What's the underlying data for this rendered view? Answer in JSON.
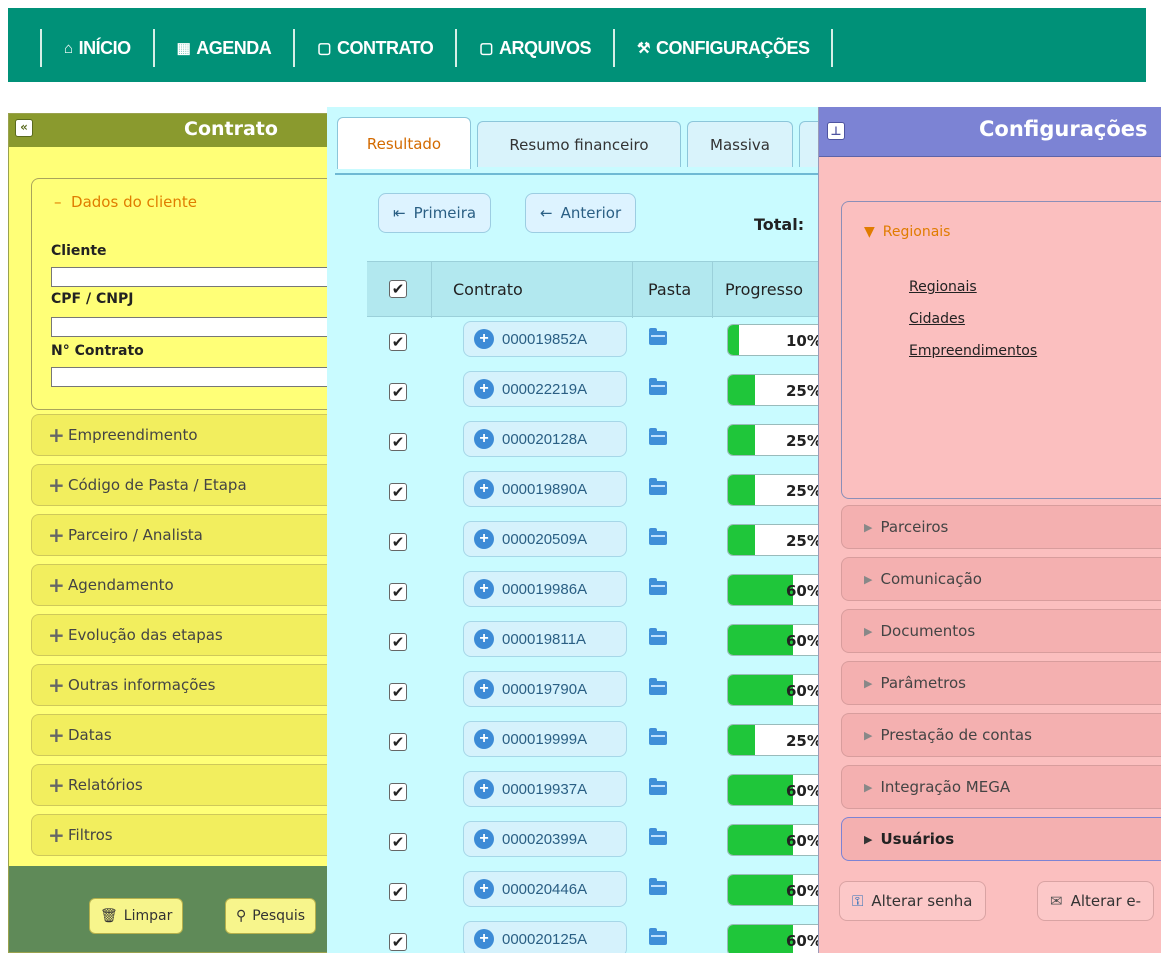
{
  "nav": {
    "items": [
      {
        "icon": "home-icon",
        "glyph": "⌂",
        "label": "INÍCIO"
      },
      {
        "icon": "calendar-icon",
        "glyph": "▦",
        "label": "AGENDA"
      },
      {
        "icon": "document-icon",
        "glyph": "▢",
        "label": "CONTRATO"
      },
      {
        "icon": "document-icon",
        "glyph": "▢",
        "label": "ARQUIVOS"
      },
      {
        "icon": "wrench-icon",
        "glyph": "⚒",
        "label": "CONFIGURAÇÕES"
      }
    ]
  },
  "contrato": {
    "title": "Contrato",
    "collapse_glyph": "«",
    "open_section": {
      "title": "Dados do cliente",
      "fields": [
        {
          "label": "Cliente",
          "value": ""
        },
        {
          "label": "CPF / CNPJ",
          "value": ""
        },
        {
          "label": "N° Contrato",
          "value": ""
        }
      ]
    },
    "sections": [
      "Empreendimento",
      "Código de Pasta / Etapa",
      "Parceiro / Analista",
      "Agendamento",
      "Evolução das etapas",
      "Outras informações",
      "Datas",
      "Relatórios",
      "Filtros"
    ],
    "buttons": {
      "clear": "Limpar",
      "search": "Pesquis"
    }
  },
  "resultado": {
    "tabs": [
      "Resultado",
      "Resumo financeiro",
      "Massiva"
    ],
    "active_tab": "Resultado",
    "pager": {
      "first": "Primeira",
      "prev": "Anterior"
    },
    "total_label": "Total:",
    "columns": [
      "Contrato",
      "Pasta",
      "Progresso"
    ],
    "rows": [
      {
        "contract": "000019852A",
        "progress_label": "10%",
        "progress": 10
      },
      {
        "contract": "000022219A",
        "progress_label": "25%",
        "progress": 25
      },
      {
        "contract": "000020128A",
        "progress_label": "25%",
        "progress": 25
      },
      {
        "contract": "000019890A",
        "progress_label": "25%",
        "progress": 25
      },
      {
        "contract": "000020509A",
        "progress_label": "25%",
        "progress": 25
      },
      {
        "contract": "000019986A",
        "progress_label": "60%",
        "progress": 60
      },
      {
        "contract": "000019811A",
        "progress_label": "60%",
        "progress": 60
      },
      {
        "contract": "000019790A",
        "progress_label": "60%",
        "progress": 60
      },
      {
        "contract": "000019999A",
        "progress_label": "25%",
        "progress": 25
      },
      {
        "contract": "000019937A",
        "progress_label": "60%",
        "progress": 60
      },
      {
        "contract": "000020399A",
        "progress_label": "60%",
        "progress": 60
      },
      {
        "contract": "000020446A",
        "progress_label": "60%",
        "progress": 60
      },
      {
        "contract": "000020125A",
        "progress_label": "60%",
        "progress": 60
      }
    ]
  },
  "config": {
    "title": "Configurações",
    "open_section": {
      "title": "Regionais",
      "links": [
        "Regionais",
        "Cidades",
        "Empreendimentos"
      ]
    },
    "sections": [
      "Parceiros",
      "Comunicação",
      "Documentos",
      "Parâmetros",
      "Prestação de contas",
      "Integração MEGA",
      "Usuários"
    ],
    "highlighted_section": "Usuários",
    "buttons": {
      "change_password": "Alterar senha",
      "change_email": "Alterar e-"
    }
  },
  "colors": {
    "nav_bg": "#009178",
    "contrato_bg": "#ffff77",
    "resultado_bg": "#c9fbff",
    "config_bg": "#fbbfbf",
    "progress_fill": "#1fc63a",
    "accent_orange": "#e07c00"
  }
}
